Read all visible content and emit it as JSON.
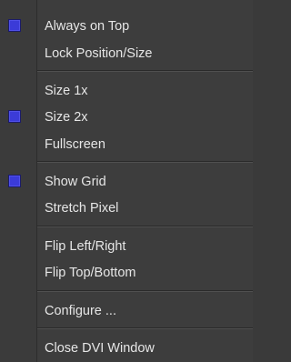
{
  "menu": {
    "items": [
      {
        "label": "Always on Top",
        "checked": true
      },
      {
        "label": "Lock Position/Size",
        "checked": false
      },
      {
        "label": "Size 1x",
        "checked": false
      },
      {
        "label": "Size 2x",
        "checked": true
      },
      {
        "label": "Fullscreen",
        "checked": false
      },
      {
        "label": "Show Grid",
        "checked": true
      },
      {
        "label": "Stretch Pixel",
        "checked": false
      },
      {
        "label": "Flip Left/Right",
        "checked": false
      },
      {
        "label": "Flip Top/Bottom",
        "checked": false
      },
      {
        "label": "Configure ...",
        "checked": false
      },
      {
        "label": "Close DVI Window",
        "checked": false
      }
    ],
    "colors": {
      "background": "#3d3d3d",
      "text": "#e6e6e6",
      "check_fill": "#3b3bd8"
    }
  }
}
